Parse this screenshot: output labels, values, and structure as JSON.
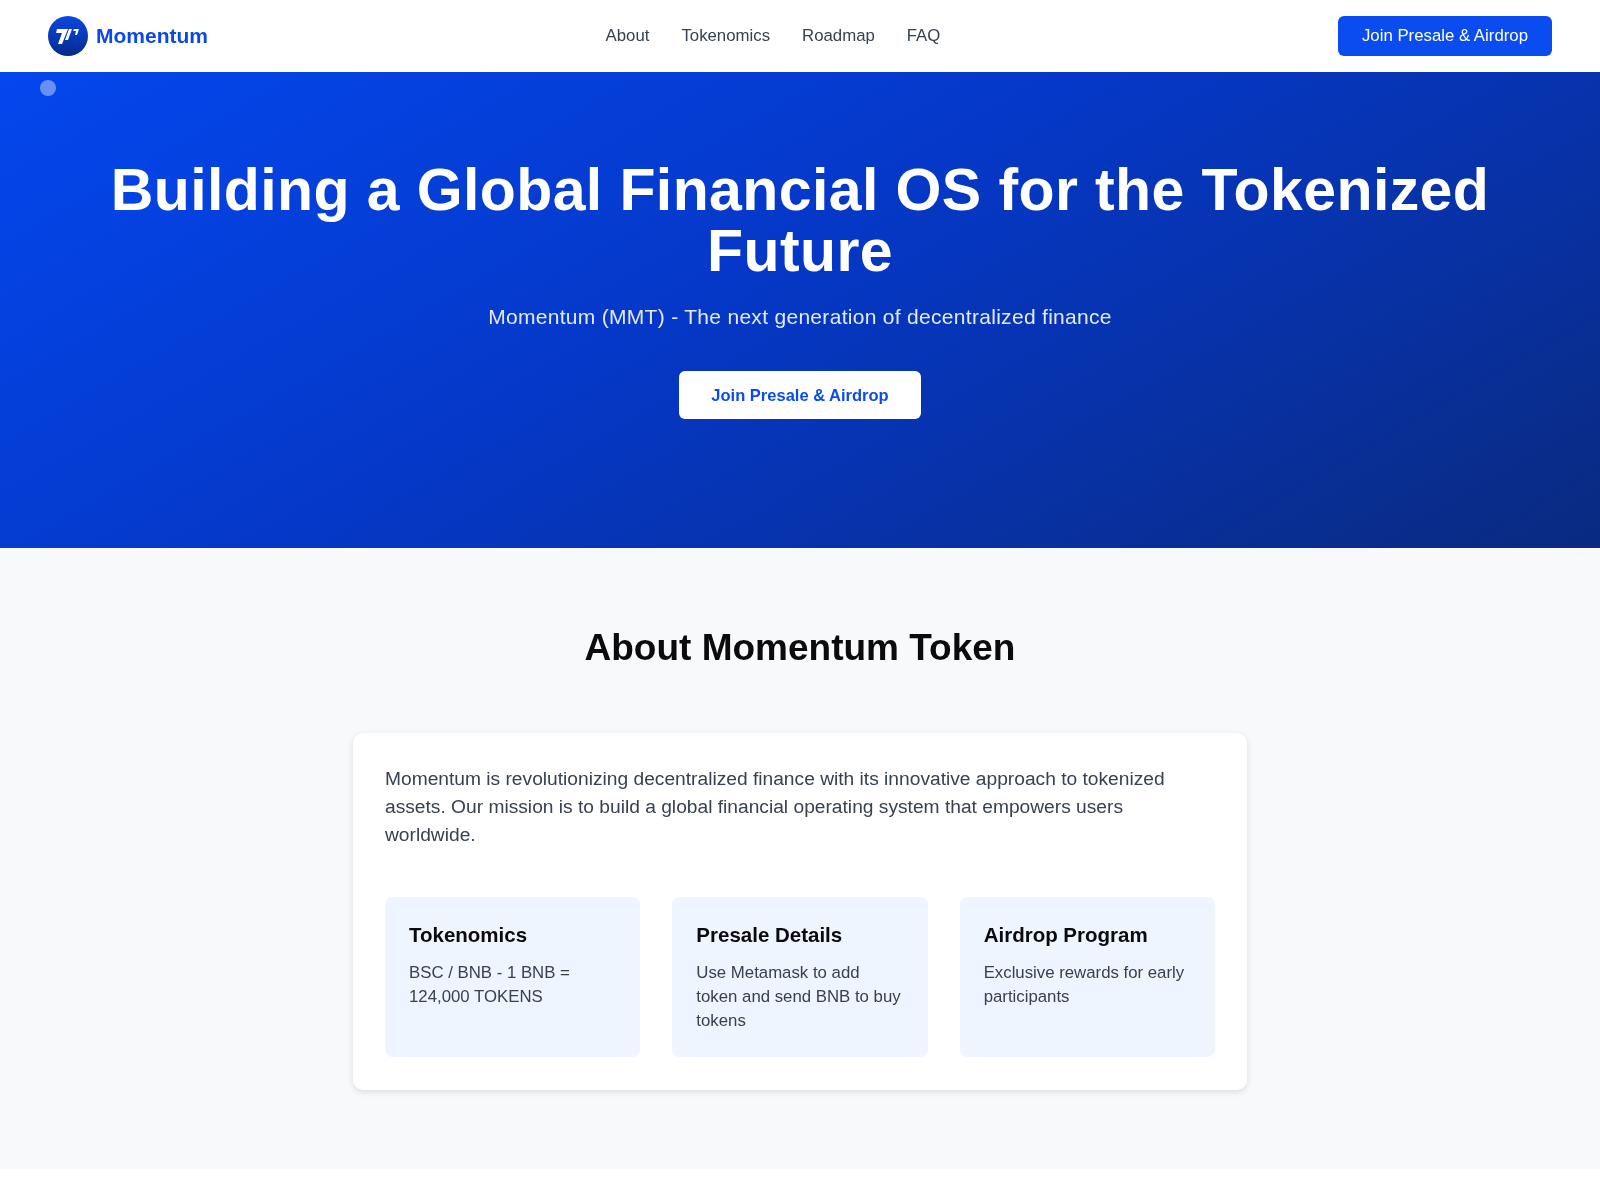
{
  "header": {
    "brand": "Momentum",
    "nav": [
      "About",
      "Tokenomics",
      "Roadmap",
      "FAQ"
    ],
    "cta": "Join Presale & Airdrop"
  },
  "hero": {
    "title": "Building a Global Financial OS for the Tokenized Future",
    "subtitle": "Momentum (MMT) - The next generation of decentralized finance",
    "cta": "Join Presale & Airdrop"
  },
  "about": {
    "title": "About Momentum Token",
    "intro": "Momentum is revolutionizing decentralized finance with its innovative approach to tokenized assets. Our mission is to build a global financial operating system that empowers users worldwide.",
    "features": [
      {
        "title": "Tokenomics",
        "text": "BSC / BNB - 1 BNB = 124,000 TOKENS"
      },
      {
        "title": "Presale Details",
        "text": "Use Metamask to add token and send BNB to buy tokens"
      },
      {
        "title": "Airdrop Program",
        "text": "Exclusive rewards for early participants"
      }
    ]
  }
}
